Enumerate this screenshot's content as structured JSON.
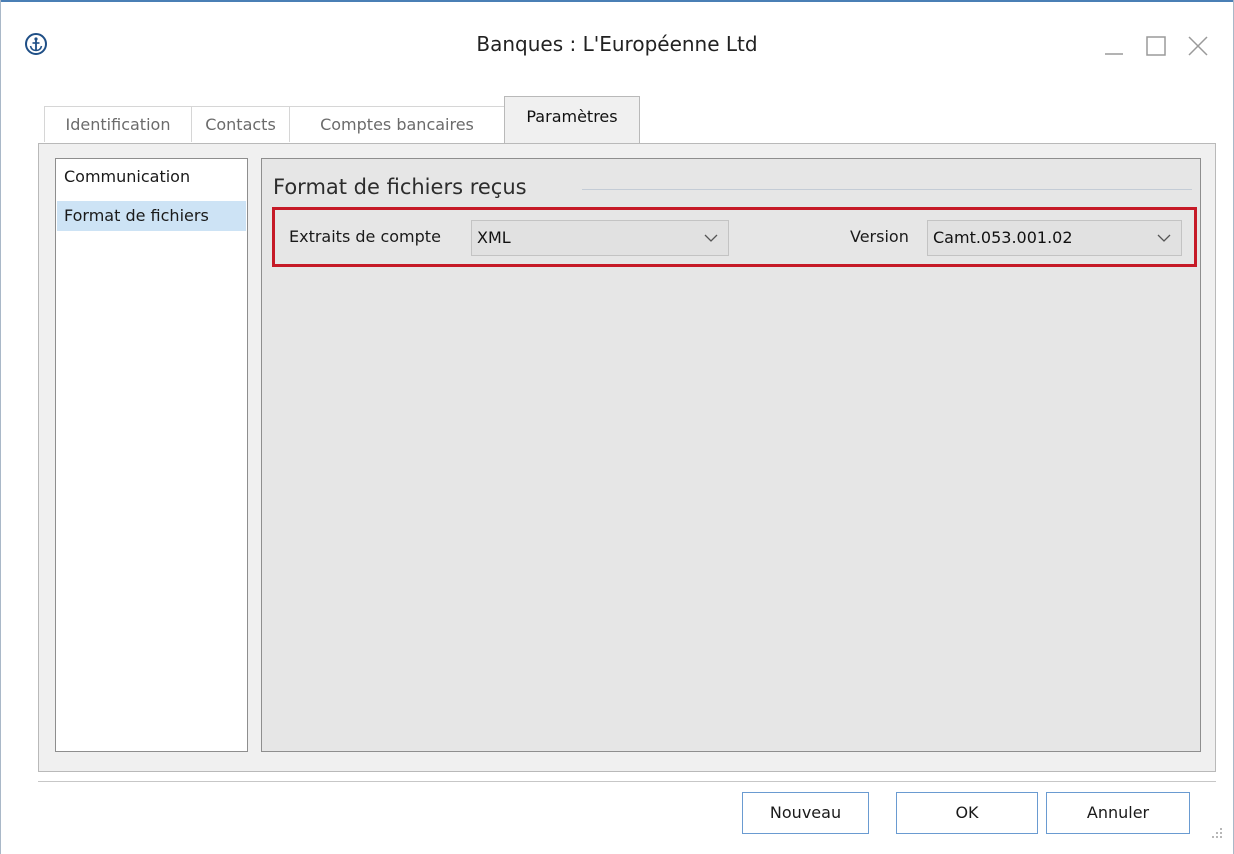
{
  "window": {
    "title": "Banques : L'Européenne Ltd",
    "accent_color": "#4a7fb5",
    "icon": "app-anchor-icon"
  },
  "tabs": [
    {
      "label": "Identification",
      "active": false
    },
    {
      "label": "Contacts",
      "active": false
    },
    {
      "label": "Comptes bancaires",
      "active": false
    },
    {
      "label": "Paramètres",
      "active": true
    }
  ],
  "sidebar": {
    "items": [
      {
        "label": "Communication",
        "selected": false
      },
      {
        "label": "Format de fichiers",
        "selected": true
      }
    ],
    "selected_color": "#cde3f5"
  },
  "section": {
    "title": "Format de fichiers reçus",
    "highlight_color": "#c61a27",
    "extraits": {
      "label": "Extraits de compte",
      "value": "XML"
    },
    "version": {
      "label": "Version",
      "value": "Camt.053.001.02"
    }
  },
  "buttons": {
    "nouveau": "Nouveau",
    "ok": "OK",
    "annuler": "Annuler"
  }
}
